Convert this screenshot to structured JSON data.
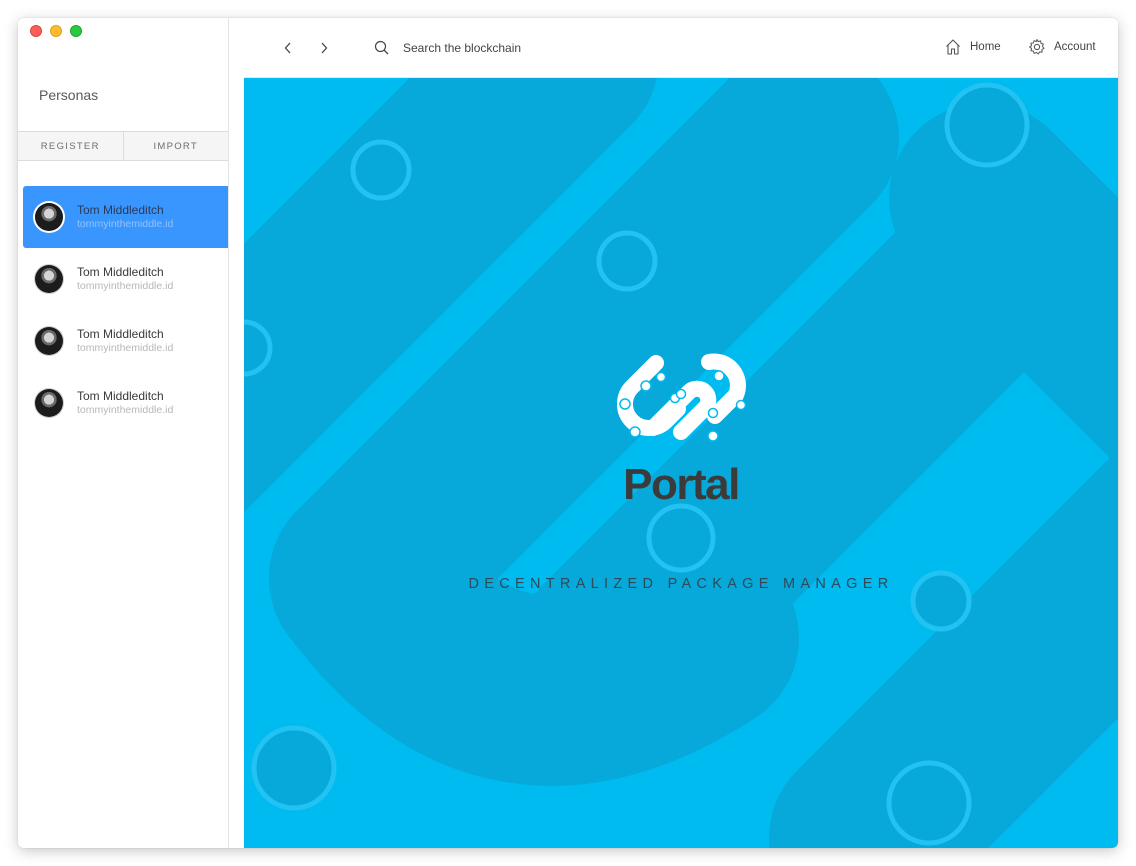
{
  "sidebar": {
    "title": "Personas",
    "tabs": [
      "REGISTER",
      "IMPORT"
    ],
    "personas": [
      {
        "name": "Tom Middleditch",
        "id": "tommyinthemiddle.id",
        "active": true
      },
      {
        "name": "Tom Middleditch",
        "id": "tommyinthemiddle.id",
        "active": false
      },
      {
        "name": "Tom Middleditch",
        "id": "tommyinthemiddle.id",
        "active": false
      },
      {
        "name": "Tom Middleditch",
        "id": "tommyinthemiddle.id",
        "active": false
      }
    ]
  },
  "toolbar": {
    "back_icon": "chevron-left-icon",
    "forward_icon": "chevron-right-icon",
    "search_placeholder": "Search the blockchain",
    "home_label": "Home",
    "account_label": "Account"
  },
  "hero": {
    "wordmark": "Portal",
    "tagline": "DECENTRALIZED PACKAGE MANAGER"
  },
  "colors": {
    "hero_bg": "#00bbf0",
    "hero_shape": "#06a9d9",
    "active_persona": "#3a96ff",
    "wordmark": "#3b3b3b"
  }
}
